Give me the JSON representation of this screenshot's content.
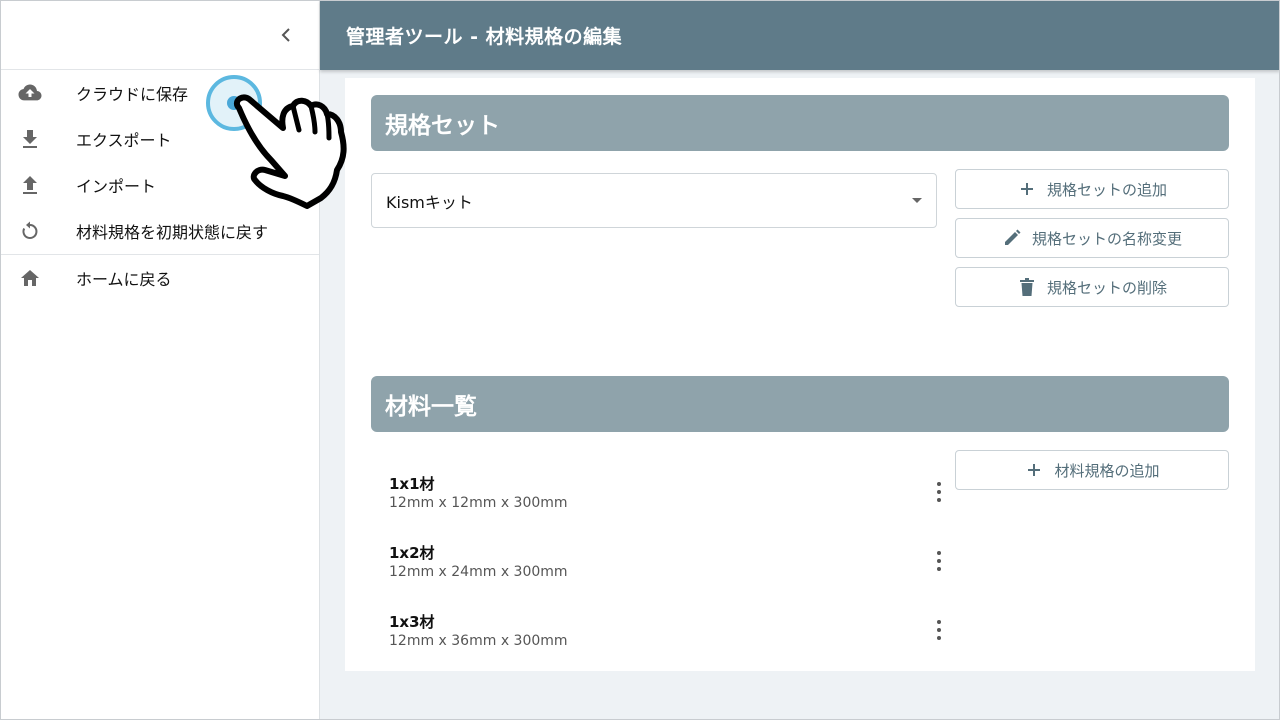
{
  "sidebar": {
    "items": [
      {
        "label": "クラウドに保存",
        "icon": "cloud-upload-icon"
      },
      {
        "label": "エクスポート",
        "icon": "download-icon"
      },
      {
        "label": "インポート",
        "icon": "upload-icon"
      },
      {
        "label": "材料規格を初期状態に戻す",
        "icon": "reset-icon"
      },
      {
        "label": "ホームに戻る",
        "icon": "home-icon"
      }
    ]
  },
  "header": {
    "title": "管理者ツール - 材料規格の編集"
  },
  "spec_set": {
    "title": "規格セット",
    "selected": "Kismキット",
    "add_label": "規格セットの追加",
    "rename_label": "規格セットの名称変更",
    "delete_label": "規格セットの削除"
  },
  "materials": {
    "title": "材料一覧",
    "add_label": "材料規格の追加",
    "items": [
      {
        "name": "1x1材",
        "size": "12mm x 12mm x 300mm"
      },
      {
        "name": "1x2材",
        "size": "12mm x 24mm x 300mm"
      },
      {
        "name": "1x3材",
        "size": "12mm x 36mm x 300mm"
      }
    ]
  },
  "colors": {
    "header": "#5f7b89",
    "section": "#8fa3ab",
    "accent": "#5cb8e0"
  }
}
